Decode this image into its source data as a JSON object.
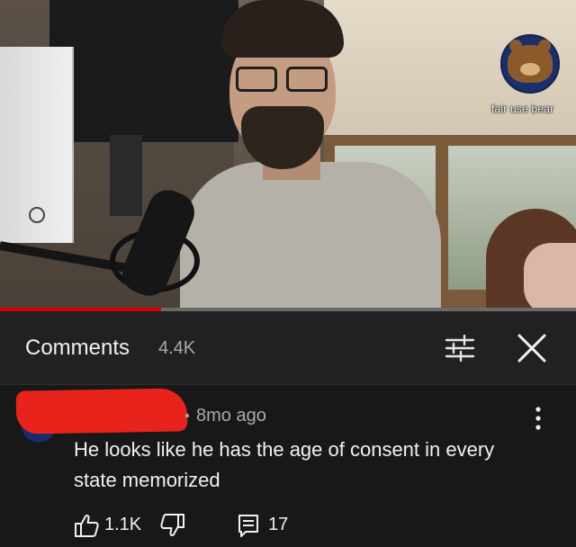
{
  "video": {
    "watermark": "fair use bear",
    "progress_fraction": 0.28,
    "progress_color": "#e00000"
  },
  "comments": {
    "title": "Comments",
    "count": "4.4K",
    "sort_icon": "sort-filter-icon",
    "close_icon": "close-icon"
  },
  "comment": {
    "time": "8mo ago",
    "text": "He looks like he has the age of consent in every state memorized",
    "likes": "1.1K",
    "replies": "17",
    "more_icon": "vertical-ellipsis-icon"
  },
  "colors": {
    "background": "#181818",
    "header_background": "#212121",
    "primary_text": "#f1f1f1",
    "secondary_text": "#aaaaaa",
    "redaction": "#e8231b"
  }
}
